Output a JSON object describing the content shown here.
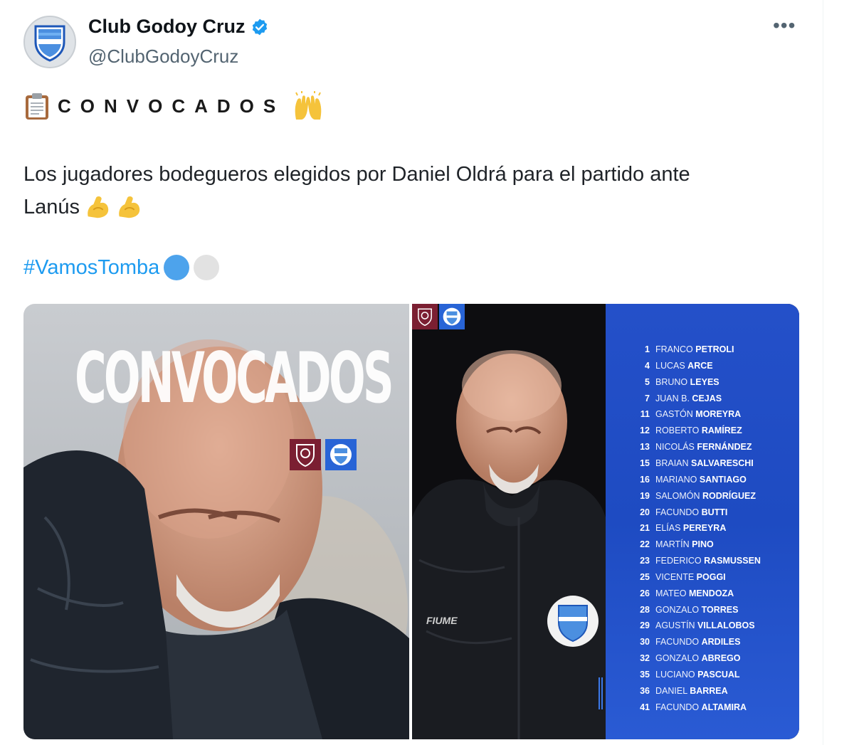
{
  "author": {
    "name": "Club Godoy Cruz",
    "handle": "@ClubGodoyCruz"
  },
  "icons": {
    "verified": "verified-badge-icon",
    "more": "more-options-icon",
    "clipboard": "clipboard-emoji",
    "raised_hands": "raising-hands-emoji",
    "flexed_biceps": "flexed-biceps-emoji"
  },
  "tweet": {
    "headline": "CONVOCADOS",
    "body_line1": "Los jugadores bodegueros elegidos por Daniel Oldrá para el partido ante",
    "body_line2": "Lanús",
    "hashtag": "#VamosTomba",
    "hashtag_circle_colors": [
      "#4da3ec",
      "#e2e2e2"
    ]
  },
  "colors": {
    "link": "#1d9bf0",
    "lanus_maroon": "#7b1f32",
    "godoy_blue": "#1e4bc2"
  },
  "media": {
    "left_title": "CONVOCADOS",
    "jacket_brand": "FIUME",
    "players": [
      {
        "num": "1",
        "first": "FRANCO",
        "last": "PETROLI"
      },
      {
        "num": "4",
        "first": "LUCAS",
        "last": "ARCE"
      },
      {
        "num": "5",
        "first": "BRUNO",
        "last": "LEYES"
      },
      {
        "num": "7",
        "first": "JUAN B.",
        "last": "CEJAS"
      },
      {
        "num": "11",
        "first": "GASTÓN",
        "last": "MOREYRA"
      },
      {
        "num": "12",
        "first": "ROBERTO",
        "last": "RAMÍREZ"
      },
      {
        "num": "13",
        "first": "NICOLÁS",
        "last": "FERNÁNDEZ"
      },
      {
        "num": "15",
        "first": "BRAIAN",
        "last": "SALVARESCHI"
      },
      {
        "num": "16",
        "first": "MARIANO",
        "last": "SANTIAGO"
      },
      {
        "num": "19",
        "first": "SALOMÓN",
        "last": "RODRÍGUEZ"
      },
      {
        "num": "20",
        "first": "FACUNDO",
        "last": "BUTTI"
      },
      {
        "num": "21",
        "first": "ELÍAS",
        "last": "PEREYRA"
      },
      {
        "num": "22",
        "first": "MARTÍN",
        "last": "PINO"
      },
      {
        "num": "23",
        "first": "FEDERICO",
        "last": "RASMUSSEN"
      },
      {
        "num": "25",
        "first": "VICENTE",
        "last": "POGGI"
      },
      {
        "num": "26",
        "first": "MATEO",
        "last": "MENDOZA"
      },
      {
        "num": "28",
        "first": "GONZALO",
        "last": "TORRES"
      },
      {
        "num": "29",
        "first": "AGUSTÍN",
        "last": "VILLALOBOS"
      },
      {
        "num": "30",
        "first": "FACUNDO",
        "last": "ARDILES"
      },
      {
        "num": "32",
        "first": "GONZALO",
        "last": "ABREGO"
      },
      {
        "num": "35",
        "first": "LUCIANO",
        "last": "PASCUAL"
      },
      {
        "num": "36",
        "first": "DANIEL",
        "last": "BARREA"
      },
      {
        "num": "41",
        "first": "FACUNDO",
        "last": "ALTAMIRA"
      }
    ]
  }
}
